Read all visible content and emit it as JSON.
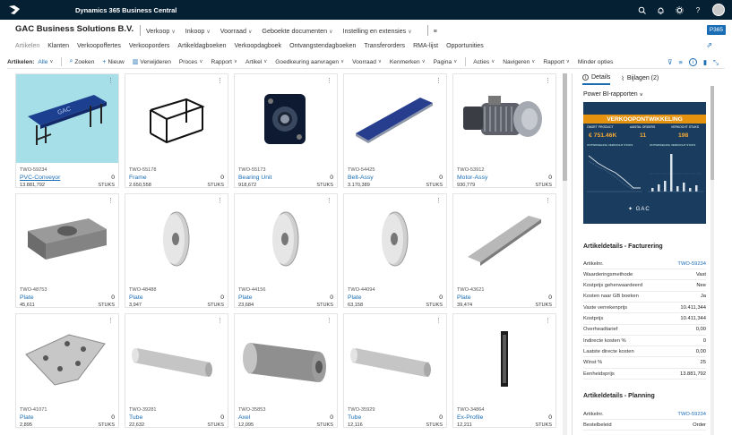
{
  "app": {
    "name": "Dynamics 365 Business Central"
  },
  "company": "GAC Business Solutions B.V.",
  "env_badge": "P365",
  "topnav": [
    {
      "label": "Verkoop",
      "chev": "∨"
    },
    {
      "label": "Inkoop",
      "chev": "∨"
    },
    {
      "label": "Voorraad",
      "chev": "∨"
    },
    {
      "label": "Geboekte documenten",
      "chev": "∨"
    },
    {
      "label": "Instelling en extensies",
      "chev": "∨"
    }
  ],
  "subnav": [
    "Artikelen",
    "Klanten",
    "Verkoopoffertes",
    "Verkooporders",
    "Artikeldagboeken",
    "Verkoopdagboek",
    "Ontvangstendagboeken",
    "Transferorders",
    "RMA-lijst",
    "Opportunities"
  ],
  "actionbar": {
    "view_label": "Artikelen:",
    "view_value": "Alle",
    "items": [
      {
        "label": "Zoeken",
        "icon": "⌕"
      },
      {
        "label": "Nieuw",
        "icon": "+"
      },
      {
        "label": "Verwijderen",
        "icon": "🗑"
      },
      {
        "label": "Proces",
        "chev": "∨"
      },
      {
        "label": "Rapport",
        "chev": "∨"
      },
      {
        "label": "Artikel",
        "chev": "∨"
      },
      {
        "label": "Goedkeuring aanvragen",
        "chev": "∨"
      },
      {
        "label": "Voorraad",
        "chev": "∨"
      },
      {
        "label": "Kenmerken",
        "chev": "∨"
      },
      {
        "label": "Pagina",
        "chev": "∨"
      },
      {
        "label": "Acties",
        "chev": "∨"
      },
      {
        "label": "Navigeren",
        "chev": "∨"
      },
      {
        "label": "Rapport",
        "chev": "∨"
      },
      {
        "label": "Minder opties"
      }
    ]
  },
  "items": [
    {
      "no": "TWO-59234",
      "desc": "PVC-Conveyor",
      "inv": "0",
      "price": "13.881,792",
      "uom": "STUKS",
      "shape": "conveyor"
    },
    {
      "no": "TWO-55178",
      "desc": "Frame",
      "inv": "0",
      "price": "2.650,558",
      "uom": "STUKS",
      "shape": "frame"
    },
    {
      "no": "TWO-55173",
      "desc": "Bearing Unit",
      "inv": "0",
      "price": "918,672",
      "uom": "STUKS",
      "shape": "bearing"
    },
    {
      "no": "TWO-54425",
      "desc": "Belt-Assy",
      "inv": "0",
      "price": "3.170,389",
      "uom": "STUKS",
      "shape": "belt"
    },
    {
      "no": "TWO-53912",
      "desc": "Motor-Assy",
      "inv": "0",
      "price": "930,779",
      "uom": "STUKS",
      "shape": "motor"
    },
    {
      "no": "TWO-48753",
      "desc": "Plate",
      "inv": "0",
      "price": "45,611",
      "uom": "STUKS",
      "shape": "block"
    },
    {
      "no": "TWO-48488",
      "desc": "Plate",
      "inv": "0",
      "price": "3,947",
      "uom": "STUKS",
      "shape": "washer"
    },
    {
      "no": "TWO-44156",
      "desc": "Plate",
      "inv": "0",
      "price": "23,684",
      "uom": "STUKS",
      "shape": "washer"
    },
    {
      "no": "TWO-44094",
      "desc": "Plate",
      "inv": "0",
      "price": "63,158",
      "uom": "STUKS",
      "shape": "washer"
    },
    {
      "no": "TWO-43621",
      "desc": "Plate",
      "inv": "0",
      "price": "39,474",
      "uom": "STUKS",
      "shape": "rail"
    },
    {
      "no": "TWO-41071",
      "desc": "Plate",
      "inv": "0",
      "price": "2,895",
      "uom": "STUKS",
      "shape": "plate"
    },
    {
      "no": "TWO-39281",
      "desc": "Tube",
      "inv": "0",
      "price": "22,632",
      "uom": "STUKS",
      "shape": "tube"
    },
    {
      "no": "TWO-35853",
      "desc": "Axel",
      "inv": "0",
      "price": "12,095",
      "uom": "STUKS",
      "shape": "axle"
    },
    {
      "no": "TWO-35929",
      "desc": "Tube",
      "inv": "0",
      "price": "12,116",
      "uom": "STUKS",
      "shape": "tube"
    },
    {
      "no": "TWO-34864",
      "desc": "Ex-Profile",
      "inv": "0",
      "price": "12,211",
      "uom": "STUKS",
      "shape": "profile"
    }
  ],
  "factbox": {
    "tab_details": "Details",
    "tab_attachments": "Bijlagen (2)",
    "powerbi_title": "Power BI-rapporten",
    "pbi": {
      "header": "VERKOOPONTWIKKELING",
      "kpi_labels": [
        "OMZET PRODUCT",
        "AANTAL ORDERS",
        "VERKOCHT STUKS"
      ],
      "kpi_values": [
        "€ 751.46K",
        "11",
        "198"
      ],
      "chart_labels": [
        "ONTWIKKELING VERKOCHT STUKS",
        "ONTWIKKELING VERKOCHT STUKS"
      ],
      "brand": "GAC"
    },
    "billing_title": "Artikeldetails - Facturering",
    "billing": [
      {
        "k": "Artikelnr.",
        "v": "TWO-59234",
        "link": true
      },
      {
        "k": "Waarderingsmethode",
        "v": "Vast"
      },
      {
        "k": "Kostprijs geherwaardeerd",
        "v": "Nee"
      },
      {
        "k": "Kosten naar GB boeken",
        "v": "Ja"
      },
      {
        "k": "Vaste verrekenprijs",
        "v": "10.411,344"
      },
      {
        "k": "Kostprijs",
        "v": "10.411,344"
      },
      {
        "k": "Overheadtarief",
        "v": "0,00"
      },
      {
        "k": "Indirecte kosten %",
        "v": "0"
      },
      {
        "k": "Laatste directe kosten",
        "v": "0,00"
      },
      {
        "k": "Winst %",
        "v": "25"
      },
      {
        "k": "Eenheidsprijs",
        "v": "13.881,792"
      }
    ],
    "planning_title": "Artikeldetails - Planning",
    "planning": [
      {
        "k": "Artikelnr.",
        "v": "TWO-59234",
        "link": true
      },
      {
        "k": "Bestelbeleid",
        "v": "Order"
      }
    ]
  }
}
